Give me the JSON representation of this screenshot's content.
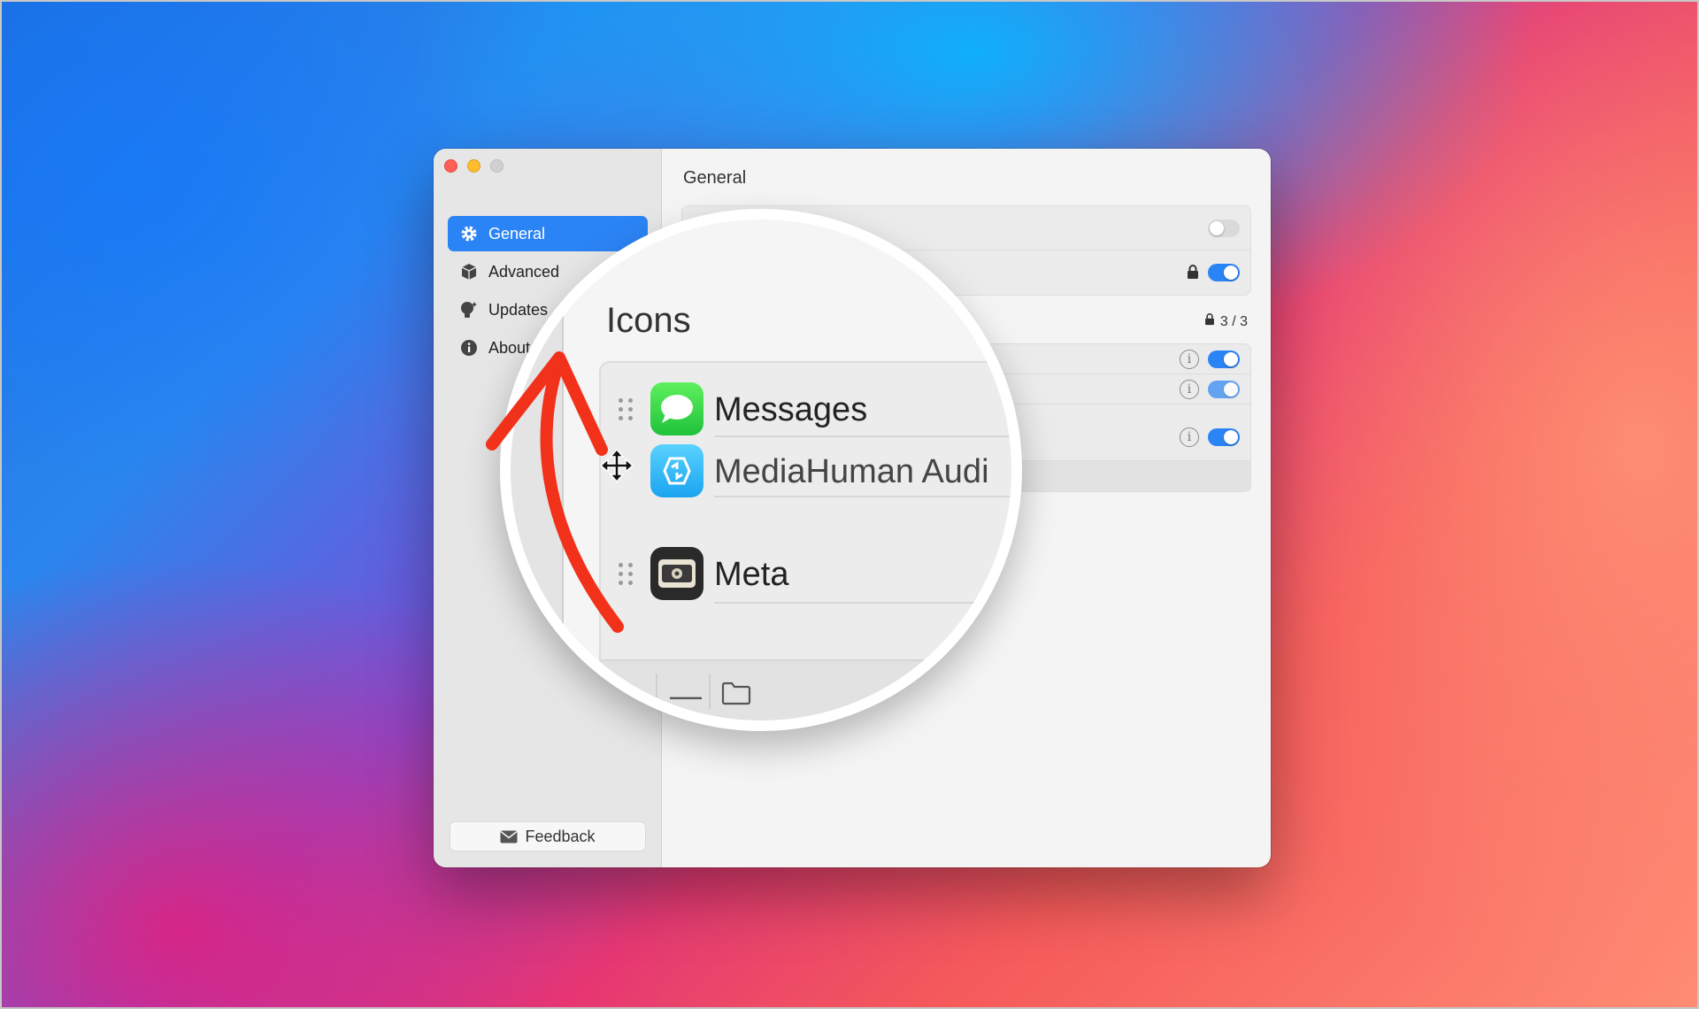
{
  "window": {
    "sidebar": {
      "items": [
        {
          "label": "General",
          "icon": "gear-icon",
          "active": true
        },
        {
          "label": "Advanced",
          "icon": "cube-icon",
          "active": false
        },
        {
          "label": "Updates",
          "icon": "lightbulb-icon",
          "active": false
        },
        {
          "label": "About",
          "icon": "info-icon",
          "active": false
        }
      ],
      "feedback_label": "Feedback"
    },
    "content": {
      "title": "General",
      "count_label": "3 / 3",
      "info_glyph": "i"
    }
  },
  "magnifier": {
    "section_title": "Icons",
    "apps": [
      {
        "name": "Messages",
        "icon": "messages-app-icon"
      },
      {
        "name": "MediaHuman Audi",
        "icon": "mediahuman-app-icon"
      },
      {
        "name": "Meta",
        "icon": "meta-app-icon"
      }
    ],
    "footer": {
      "add": "+",
      "remove": "—"
    }
  },
  "colors": {
    "accent": "#2b84f5",
    "annotation_arrow": "#f2311a"
  }
}
